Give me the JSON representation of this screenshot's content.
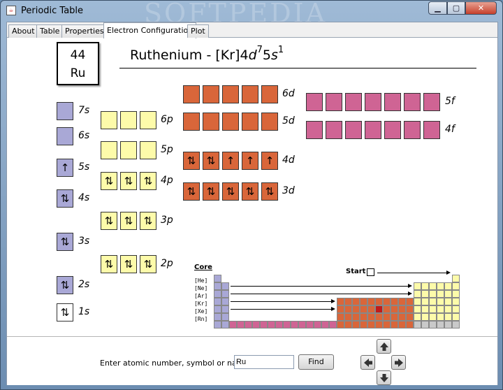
{
  "window": {
    "title": "Periodic Table",
    "watermark": "SOFTPEDIA"
  },
  "tabs": [
    {
      "label": "About"
    },
    {
      "label": "Table"
    },
    {
      "label": "Properties"
    },
    {
      "label": "Electron Configuration"
    },
    {
      "label": "Plot"
    }
  ],
  "active_tab": "Electron Configuration",
  "element": {
    "number": "44",
    "symbol": "Ru",
    "name": "Ruthenium",
    "title_prefix": "Ruthenium - [Kr]4",
    "sub1": "d",
    "sup1": "7",
    "mid": "5",
    "sub2": "s",
    "sup2": "1"
  },
  "orbitals": {
    "s": [
      {
        "label": "7s",
        "state": ""
      },
      {
        "label": "6s",
        "state": ""
      },
      {
        "label": "5s",
        "state": "↑"
      },
      {
        "label": "4s",
        "state": "⇅"
      },
      {
        "label": "3s",
        "state": "⇅"
      },
      {
        "label": "2s",
        "state": "⇅"
      },
      {
        "label": "1s",
        "state": "⇅"
      }
    ],
    "p": [
      {
        "label": "6p",
        "states": [
          "",
          "",
          ""
        ]
      },
      {
        "label": "5p",
        "states": [
          "",
          "",
          ""
        ]
      },
      {
        "label": "4p",
        "states": [
          "⇅",
          "⇅",
          "⇅"
        ]
      },
      {
        "label": "3p",
        "states": [
          "⇅",
          "⇅",
          "⇅"
        ]
      },
      {
        "label": "2p",
        "states": [
          "⇅",
          "⇅",
          "⇅"
        ]
      }
    ],
    "d": [
      {
        "label": "6d",
        "states": [
          "",
          "",
          "",
          "",
          ""
        ]
      },
      {
        "label": "5d",
        "states": [
          "",
          "",
          "",
          "",
          ""
        ]
      },
      {
        "label": "4d",
        "states": [
          "⇅",
          "⇅",
          "↑",
          "↑",
          "↑"
        ]
      },
      {
        "label": "3d",
        "states": [
          "⇅",
          "⇅",
          "⇅",
          "⇅",
          "⇅"
        ]
      }
    ],
    "f": [
      {
        "label": "5f",
        "states": [
          "",
          "",
          "",
          "",
          "",
          "",
          ""
        ]
      },
      {
        "label": "4f",
        "states": [
          "",
          "",
          "",
          "",
          "",
          "",
          ""
        ]
      }
    ]
  },
  "core": {
    "label": "Core",
    "rows": [
      "[He]",
      "[Ne]",
      "[Ar]",
      "[Kr]",
      "[Xe]",
      "[Rn]"
    ],
    "start_label": "Start"
  },
  "search": {
    "prompt": "Enter atomic number, symbol or name:",
    "value": "Ru",
    "find_label": "Find"
  },
  "colors": {
    "s": "#a9a8d6",
    "p": "#fdfbaa",
    "d": "#d9663a",
    "f": "#cf6494",
    "selected": "#c11a1a"
  }
}
